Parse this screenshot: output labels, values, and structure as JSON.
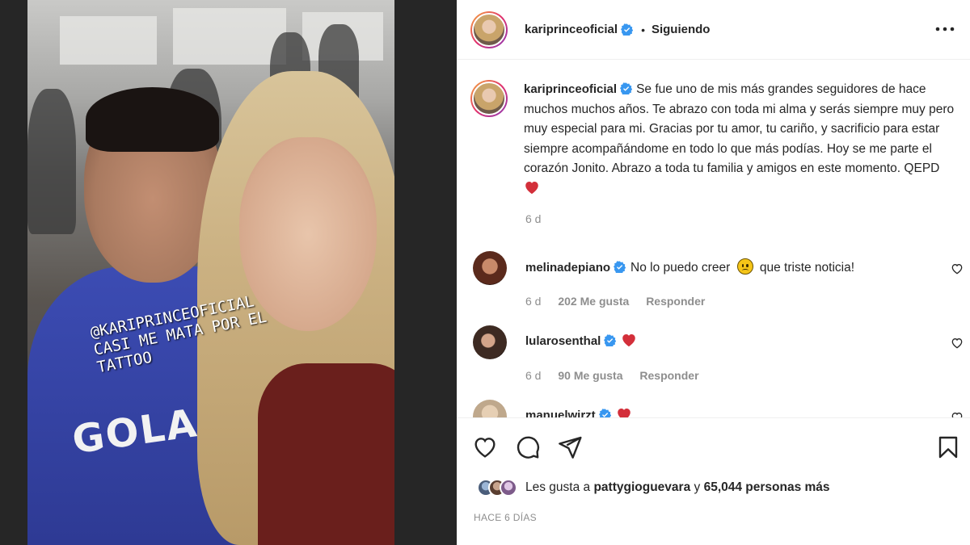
{
  "post": {
    "author": "kariprinceoficial",
    "follow_separator": "•",
    "follow_status": "Siguiendo",
    "sticker_text": "@KARIPRINCEOFICIAL CASI ME MATA POR EL TATTOO",
    "shirt_print": "GOLA"
  },
  "caption": {
    "username": "kariprinceoficial",
    "text": "Se fue uno de mis más grandes seguidores de hace muchos muchos años. Te abrazo con toda mi alma y serás siempre muy pero muy especial para mi. Gracias por tu amor, tu cariño, y sacrificio para estar siempre acompañándome en todo lo que más podías. Hoy se me parte el corazón Jonito. Abrazo a toda tu familia y amigos en este momento. QEPD",
    "time": "6 d"
  },
  "comments": [
    {
      "username": "melinadepiano",
      "text": "No lo puedo creer",
      "emoji": "🙁",
      "text_after": "que triste noticia!",
      "time": "6 d",
      "likes": "202 Me gusta",
      "reply": "Responder"
    },
    {
      "username": "lularosenthal",
      "text": "",
      "time": "6 d",
      "likes": "90 Me gusta",
      "reply": "Responder"
    },
    {
      "username": "manuelwirzt",
      "text": ""
    }
  ],
  "likes": {
    "prefix": "Les gusta a",
    "user": "pattygioguevara",
    "connector": "y",
    "others": "65,044 personas más"
  },
  "post_date": "HACE 6 DÍAS",
  "icons": {
    "more": "more-horizontal-icon",
    "like": "heart-icon",
    "comment": "comment-icon",
    "share": "paper-plane-icon",
    "save": "bookmark-icon",
    "verified": "verified-badge-icon"
  },
  "colors": {
    "verified": "#3897f0",
    "heart_red": "#ed4956",
    "text": "#262626",
    "muted": "#8e8e8e"
  }
}
